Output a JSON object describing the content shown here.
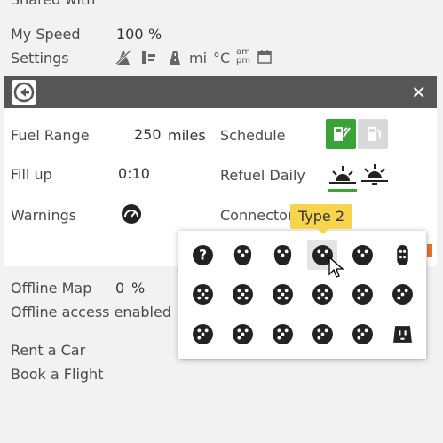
{
  "top": {
    "shared_with_label": "Shared with",
    "my_speed_label": "My Speed",
    "my_speed_value": "100",
    "my_speed_unit": "%",
    "settings_label": "Settings",
    "settings_icons": [
      "no-toll-icon",
      "ferry-icon",
      "highway-icon",
      "distance-unit",
      "temperature-unit",
      "time-format",
      "calendar-icon"
    ],
    "distance_unit": "mi",
    "temperature_unit": "°C",
    "time_am": "am",
    "time_pm": "pm"
  },
  "dialog": {
    "fuel_range_label": "Fuel Range",
    "fuel_range_value": "250",
    "fuel_range_unit": "miles",
    "schedule_label": "Schedule",
    "fill_up_label": "Fill up",
    "fill_up_value": "0:10",
    "refuel_daily_label": "Refuel Daily",
    "warnings_label": "Warnings",
    "connector_label": "Connector",
    "colors": {
      "header": "#565656",
      "accent_green": "#3aa335",
      "tooltip": "#f7d44c"
    }
  },
  "tooltip": {
    "text": "Type 2"
  },
  "connector_popup": {
    "selected_index": 3,
    "items": [
      "unknown-connector-icon",
      "type1-connector-icon",
      "type1-alt-connector-icon",
      "type2-connector-icon",
      "type2-alt-connector-icon",
      "tesla-connector-icon",
      "ccs-connector-icon",
      "chademo-connector-icon",
      "gbt-connector-icon",
      "cee-connector-icon",
      "domestic-a-connector-icon",
      "domestic-b-connector-icon",
      "schuko-connector-icon",
      "domestic-c-connector-icon",
      "domestic-d-connector-icon",
      "domestic-e-connector-icon",
      "domestic-f-connector-icon",
      "nema-connector-icon"
    ]
  },
  "bottom": {
    "offline_map_label": "Offline Map",
    "offline_map_value": "0",
    "offline_map_unit": "%",
    "offline_access_text": "Offline access enabled",
    "rent_car_link": "Rent a Car",
    "book_flight_link": "Book a Flight"
  }
}
